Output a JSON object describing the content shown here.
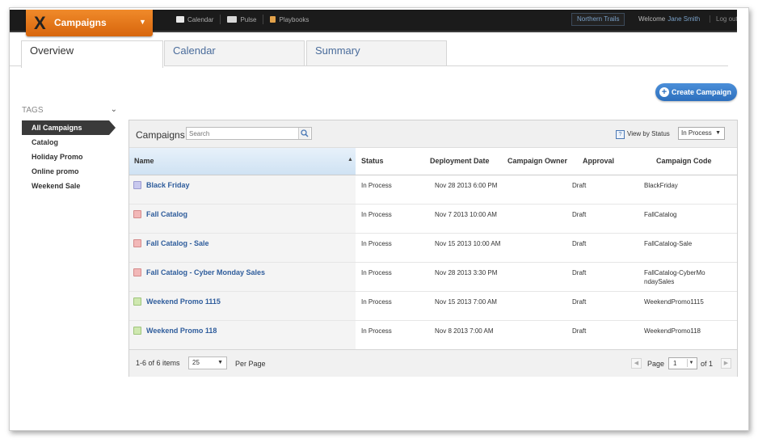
{
  "app": {
    "title": "Campaigns",
    "logo": "X",
    "dropdown_icon": "chevron-down-icon"
  },
  "topnav": {
    "items": [
      {
        "label": "Calendar",
        "icon": "calendar-icon"
      },
      {
        "label": "Pulse",
        "icon": "pulse-icon"
      },
      {
        "label": "Playbooks",
        "icon": "playbooks-icon"
      }
    ],
    "org": "Northern Trails",
    "welcome_label": "Welcome",
    "user_name": "Jane Smith",
    "logout": "Log out"
  },
  "tabs": [
    {
      "label": "Overview"
    },
    {
      "label": "Calendar"
    },
    {
      "label": "Summary"
    }
  ],
  "create_button": {
    "label": "Create Campaign"
  },
  "tags": {
    "heading": "TAGS",
    "items": [
      {
        "label": "All Campaigns"
      },
      {
        "label": "Catalog"
      },
      {
        "label": "Holiday Promo"
      },
      {
        "label": "Online promo"
      },
      {
        "label": "Weekend Sale"
      }
    ]
  },
  "panel": {
    "title": "Campaigns",
    "search_placeholder": "Search",
    "view_by_label": "View by Status",
    "status_value": "In Process"
  },
  "columns": [
    "Name",
    "Status",
    "Deployment Date",
    "Campaign Owner",
    "Approval",
    "Campaign Code"
  ],
  "rows": [
    {
      "name": "Black Friday",
      "color": "#c8c8ee",
      "status": "In Process",
      "date": "Nov 28 2013 6:00 PM",
      "owner": "",
      "approval": "Draft",
      "code": "BlackFriday"
    },
    {
      "name": "Fall Catalog",
      "color": "#f2b8b8",
      "status": "In Process",
      "date": "Nov 7 2013 10:00 AM",
      "owner": "",
      "approval": "Draft",
      "code": "FallCatalog"
    },
    {
      "name": "Fall Catalog - Sale",
      "color": "#f2b8b8",
      "status": "In Process",
      "date": "Nov 15 2013 10:00 AM",
      "owner": "",
      "approval": "Draft",
      "code": "FallCatalog-Sale"
    },
    {
      "name": "Fall Catalog - Cyber Monday Sales",
      "color": "#f2b8b8",
      "status": "In Process",
      "date": "Nov 28 2013 3:30 PM",
      "owner": "",
      "approval": "Draft",
      "code": "FallCatalog-CyberMondaySales"
    },
    {
      "name": "Weekend Promo 1115",
      "color": "#cfe8b0",
      "status": "In Process",
      "date": "Nov 15 2013 7:00 AM",
      "owner": "",
      "approval": "Draft",
      "code": "WeekendPromo1115"
    },
    {
      "name": "Weekend Promo 118",
      "color": "#cfe8b0",
      "status": "In Process",
      "date": "Nov 8 2013 7:00 AM",
      "owner": "",
      "approval": "Draft",
      "code": "WeekendPromo118"
    }
  ],
  "footer": {
    "count": "1-6 of 6 items",
    "per_page_value": "25",
    "per_page_label": "Per Page",
    "page_label": "Page",
    "page_value": "1",
    "of_label": "of 1"
  }
}
